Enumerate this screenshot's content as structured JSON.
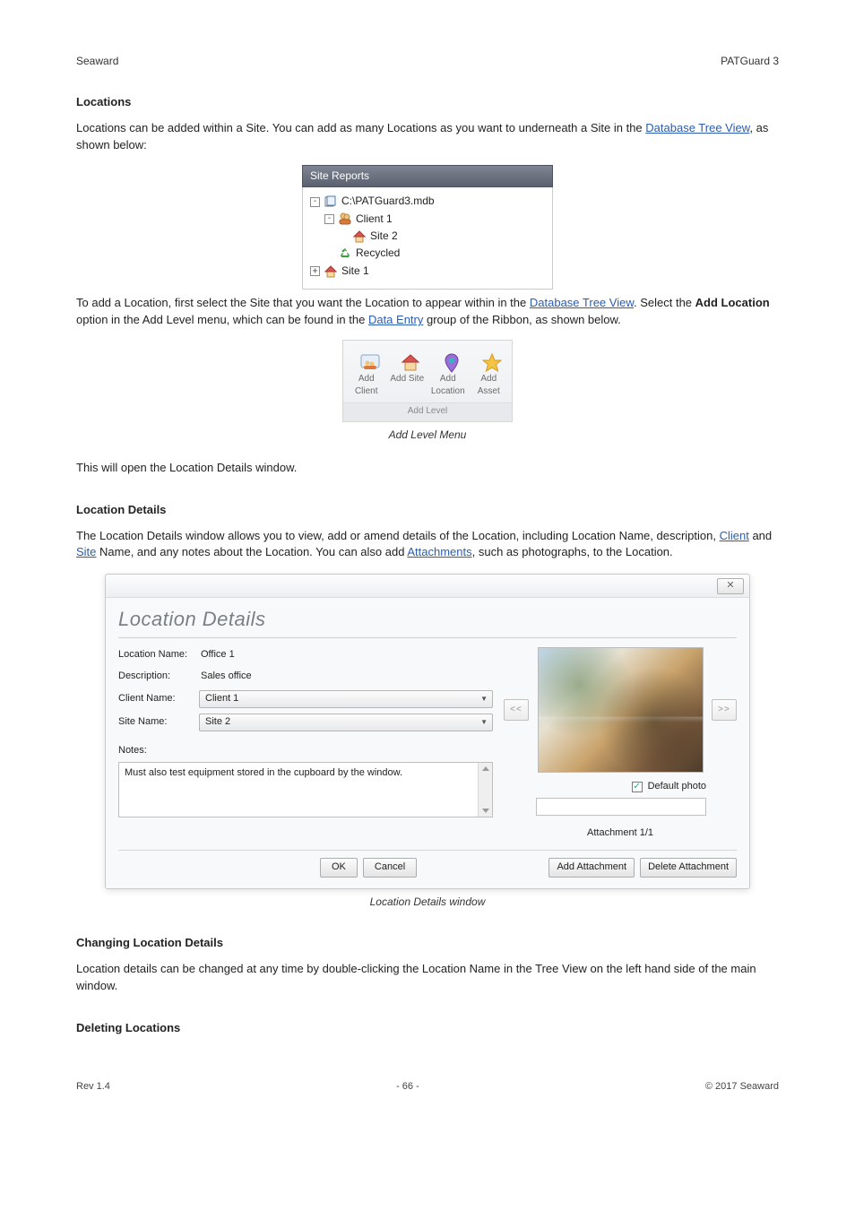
{
  "header": {
    "company": "Seaward",
    "doc_title": "PATGuard 3"
  },
  "loc_section_title": "Locations",
  "loc_intro": {
    "pre": "Locations can be added within a Site. You can add as many Locations as you want to underneath a Site in the ",
    "link": "Database Tree View",
    "post": ", as shown below:"
  },
  "tree": {
    "title": "Site Reports",
    "root": "C:\\PATGuard3.mdb",
    "client": "Client 1",
    "site2": "Site 2",
    "recycled": "Recycled",
    "site1": "Site 1"
  },
  "add_loc": {
    "pre1": "To add a Location, first select the Site that you want the Location to appear within in the ",
    "link1": "Database Tree View",
    "mid": ". Select the ",
    "bold1": "Add Location",
    "mid2": " option in the Add Level menu, which can be found in the ",
    "link2": "Data Entry",
    "post1": " group of the Ribbon, as shown below."
  },
  "ribbon": {
    "add_client": "Add Client",
    "add_site": "Add Site",
    "add_location": "Add Location",
    "add_asset": "Add Asset",
    "group": "Add Level"
  },
  "caption1": "Add Level Menu",
  "open_dlg": "This will open the Location Details window.",
  "loc_details_title": "Location Details",
  "loc_details_para": {
    "pre": "The Location Details window allows you to view, add or amend details of the Location, including Location Name, description, ",
    "link1": "Client",
    "mid": " and ",
    "link2": "Site",
    "post": " Name, and any notes about the Location. You can also add ",
    "link3": "Attachments",
    "post2": ", such as photographs, to the Location."
  },
  "dialog": {
    "heading": "Location Details",
    "lbl_location_name": "Location Name:",
    "val_location_name": "Office 1",
    "lbl_description": "Description:",
    "val_description": "Sales office",
    "lbl_client_name": "Client Name:",
    "val_client_name": "Client 1",
    "lbl_site_name": "Site Name:",
    "val_site_name": "Site 2",
    "lbl_notes": "Notes:",
    "val_notes": "Must also test equipment stored in the cupboard by the window.",
    "prev": "<<",
    "next": ">>",
    "default_photo": "Default photo",
    "attach_counter": "Attachment 1/1",
    "ok": "OK",
    "cancel": "Cancel",
    "add_attach": "Add Attachment",
    "del_attach": "Delete Attachment"
  },
  "caption2": "Location Details window",
  "change_title": "Changing Location Details",
  "change_para": "Location details can be changed at any time by double-clicking the Location Name in the Tree View on the left hand side of the main window.",
  "delete_title": "Deleting Locations",
  "footer": {
    "left": "Rev 1.4",
    "center": "- 66 -",
    "right": "© 2017 Seaward"
  }
}
